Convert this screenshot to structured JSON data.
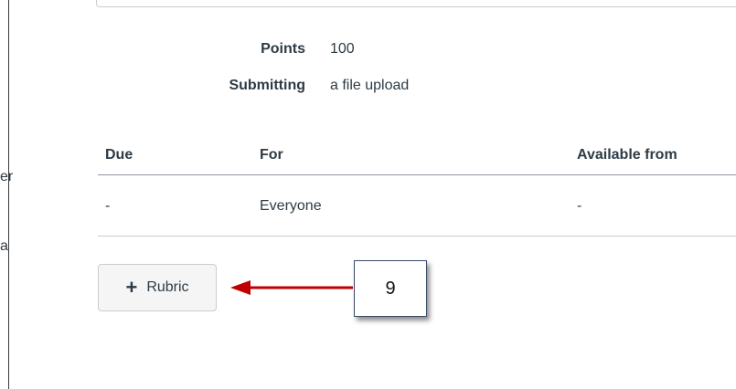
{
  "sidebar": {
    "fragment_1": "er",
    "fragment_2": "a"
  },
  "details": {
    "points_label": "Points",
    "points_value": "100",
    "submitting_label": "Submitting",
    "submitting_value": "a file upload"
  },
  "table": {
    "headers": [
      "Due",
      "For",
      "Available from"
    ],
    "rows": [
      [
        "-",
        "Everyone",
        "-"
      ]
    ]
  },
  "rubric_button": {
    "label": "Rubric",
    "icon": "plus-icon"
  },
  "annotation": {
    "callout_number": "9",
    "arrow_color": "#c00000"
  }
}
